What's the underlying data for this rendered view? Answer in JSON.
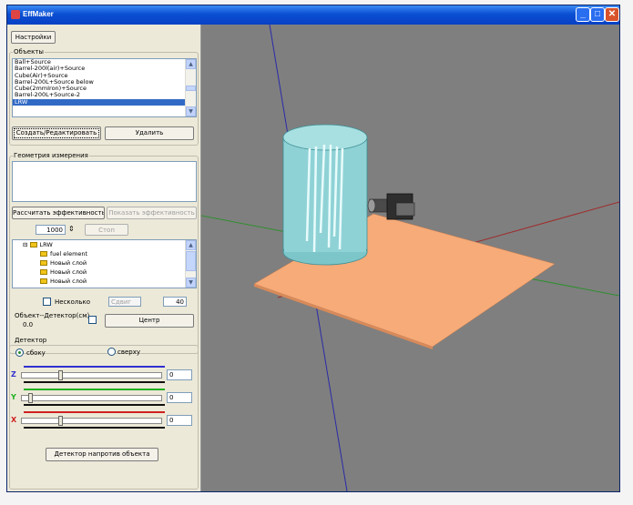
{
  "window": {
    "title": "EffMaker"
  },
  "settings_button": "Настройки",
  "objects": {
    "group_label": "Объекты",
    "items": [
      "Ball+Source",
      "Barrel-200l(air)+Source",
      "Cube(Air)+Source",
      "Barrel-200L+Source below",
      "Cube(2mmIron)+Source",
      "Barrel-200L+Source-2",
      "LRW"
    ],
    "selected_index": 6,
    "create_button": "Создать/Редактировать",
    "delete_button": "Удалить"
  },
  "geometry": {
    "group_label": "Геометрия измерения",
    "calc_button": "Рассчитать эффективность",
    "show_button": "Показать эффективность",
    "count_value": "1000",
    "stop_button": "Стоп"
  },
  "tree": {
    "root": "LRW",
    "expander": "⊟",
    "children": [
      "fuel element",
      "Новый слой",
      "Новый слой",
      "Новый слой"
    ]
  },
  "multi": {
    "label": "Несколько",
    "field1": "Сдвиг",
    "field2": "40"
  },
  "distance": {
    "label": "Объект--Детектор(см)",
    "value": "0.0",
    "center_button": "Центр"
  },
  "detector": {
    "group_label": "Детектор",
    "radio_side": "сбоку",
    "radio_top": "сверху",
    "sliders": [
      {
        "axis": "Z",
        "value": "0",
        "color": "#3030d0",
        "position": 0.27
      },
      {
        "axis": "Y",
        "value": "0",
        "color": "#20b020",
        "position": 0.05
      },
      {
        "axis": "X",
        "value": "0",
        "color": "#d02020",
        "position": 0.27
      }
    ],
    "apply_button": "Детектор напротив объекта"
  }
}
